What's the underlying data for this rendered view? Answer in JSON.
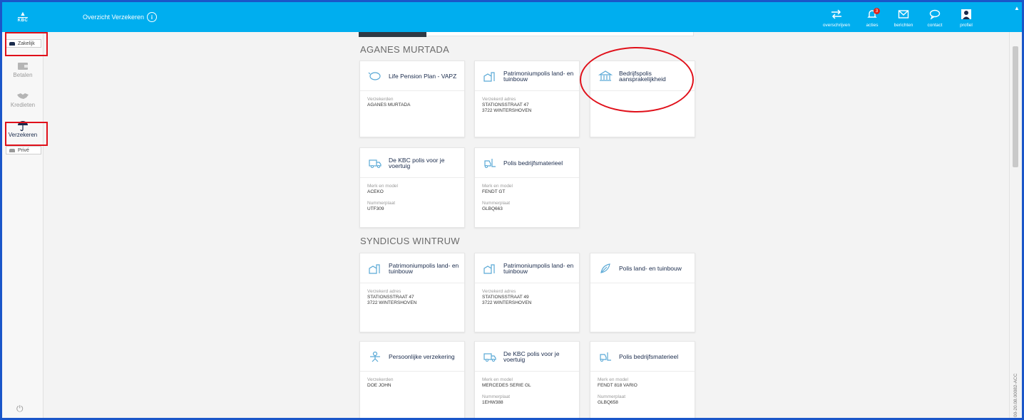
{
  "header": {
    "page_title": "Overzicht Verzekeren",
    "logo_text": "KBC",
    "actions": [
      {
        "label": "overschrijven",
        "icon": "transfer-icon"
      },
      {
        "label": "acties",
        "icon": "bell-icon",
        "badge": "3"
      },
      {
        "label": "berichten",
        "icon": "envelope-icon"
      },
      {
        "label": "contact",
        "icon": "chat-bubble-icon"
      },
      {
        "label": "profiel",
        "icon": "profile-icon"
      }
    ]
  },
  "sidebar": {
    "toggle_top": "Zakelijk",
    "toggle_bottom": "Privé",
    "items": [
      {
        "label": "Betalen",
        "icon": "wallet-icon"
      },
      {
        "label": "Kredieten",
        "icon": "handshake-icon"
      },
      {
        "label": "Verzekeren",
        "icon": "umbrella-icon"
      }
    ]
  },
  "sections": [
    {
      "title": "AGANES MURTADA",
      "cards": [
        {
          "title": "Life Pension Plan - VAPZ",
          "icon": "piggybank-icon",
          "fields": [
            {
              "label": "Verzekerden",
              "value": "AGANES MURTADA"
            }
          ]
        },
        {
          "title": "Patrimoniumpolis land- en tuinbouw",
          "icon": "farm-building-icon",
          "fields": [
            {
              "label": "Verzekerd adres",
              "value": "STATIONSSTRAAT 47",
              "value2": "3722 WINTERSHOVEN"
            }
          ]
        },
        {
          "title": "Bedrijfspolis aansprakelijkheid",
          "icon": "bank-building-icon",
          "fields": []
        },
        {
          "title": "De KBC polis voor je voertuig",
          "icon": "truck-icon",
          "fields": [
            {
              "label": "Merk en model",
              "value": "ACEKO"
            },
            {
              "label": "Nummerplaat",
              "value": "UTF309"
            }
          ]
        },
        {
          "title": "Polis bedrijfsmaterieel",
          "icon": "forklift-icon",
          "fields": [
            {
              "label": "Merk en model",
              "value": "FENDT GT"
            },
            {
              "label": "Nummerplaat",
              "value": "GLBQ663"
            }
          ]
        }
      ]
    },
    {
      "title": "SYNDICUS WINTRUW",
      "cards": [
        {
          "title": "Patrimoniumpolis land- en tuinbouw",
          "icon": "farm-building-icon",
          "fields": [
            {
              "label": "Verzekerd adres",
              "value": "STATIONSSTRAAT 47",
              "value2": "3722 WINTERSHOVEN"
            }
          ]
        },
        {
          "title": "Patrimoniumpolis land- en tuinbouw",
          "icon": "farm-building-icon",
          "fields": [
            {
              "label": "Verzekerd adres",
              "value": "STATIONSSTRAAT 49",
              "value2": "3722 WINTERSHOVEN"
            }
          ]
        },
        {
          "title": "Polis land- en tuinbouw",
          "icon": "leaf-icon",
          "fields": []
        },
        {
          "title": "Persoonlijke verzekering",
          "icon": "person-icon",
          "fields": [
            {
              "label": "Verzekerden",
              "value": "DOE JOHN"
            }
          ]
        },
        {
          "title": "De KBC polis voor je voertuig",
          "icon": "truck-icon",
          "fields": [
            {
              "label": "Merk en model",
              "value": "MERCEDES SERIE GL"
            },
            {
              "label": "Nummerplaat",
              "value": "1EHW388"
            }
          ]
        },
        {
          "title": "Polis bedrijfsmaterieel",
          "icon": "forklift-icon",
          "fields": [
            {
              "label": "Merk en model",
              "value": "FENDT 818 VARIO"
            },
            {
              "label": "Nummerplaat",
              "value": "GLBQ658"
            }
          ]
        }
      ]
    }
  ],
  "footer": {
    "version": "00-20.08.00082-ACC"
  },
  "colors": {
    "header": "#00aeef",
    "accent": "#1a2b4c",
    "annotation": "#e0101a"
  }
}
